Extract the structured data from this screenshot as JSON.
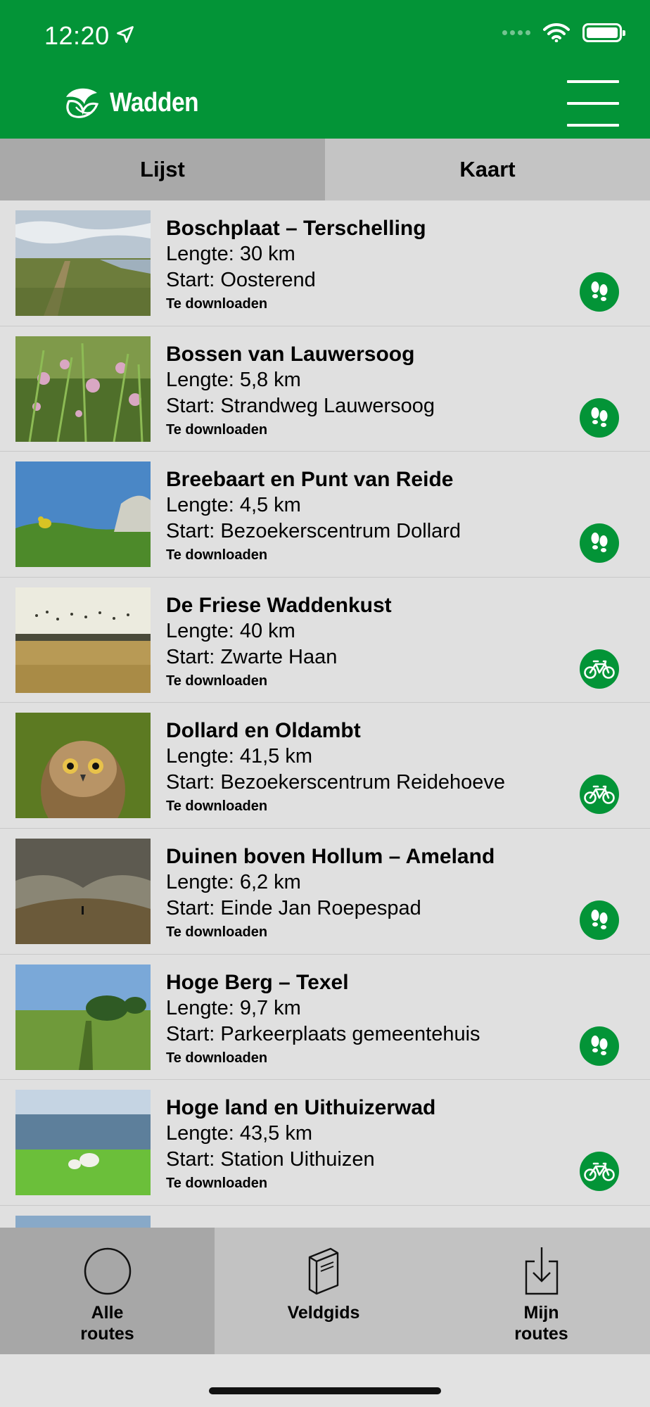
{
  "status_bar": {
    "time": "12:20"
  },
  "header": {
    "app_name": "Wadden"
  },
  "tabs": [
    {
      "label": "Lijst",
      "active": true
    },
    {
      "label": "Kaart",
      "active": false
    }
  ],
  "routes": [
    {
      "title": "Boschplaat – Terschelling",
      "length": "Lengte: 30 km",
      "start": "Start: Oosterend",
      "status": "Te downloaden",
      "mode": "walk"
    },
    {
      "title": "Bossen van Lauwersoog",
      "length": "Lengte: 5,8 km",
      "start": "Start: Strandweg Lauwersoog",
      "status": "Te downloaden",
      "mode": "walk"
    },
    {
      "title": "Breebaart en Punt van Reide",
      "length": "Lengte: 4,5 km",
      "start": "Start: Bezoekerscentrum Dollard",
      "status": "Te downloaden",
      "mode": "walk"
    },
    {
      "title": "De Friese Waddenkust",
      "length": "Lengte: 40 km",
      "start": "Start: Zwarte Haan",
      "status": "Te downloaden",
      "mode": "bike"
    },
    {
      "title": "Dollard en Oldambt",
      "length": "Lengte: 41,5 km",
      "start": "Start: Bezoekerscentrum Reidehoeve",
      "status": "Te downloaden",
      "mode": "bike"
    },
    {
      "title": "Duinen boven Hollum – Ameland",
      "length": "Lengte: 6,2 km",
      "start": "Start: Einde Jan Roepespad",
      "status": "Te downloaden",
      "mode": "walk"
    },
    {
      "title": "Hoge Berg – Texel",
      "length": "Lengte: 9,7 km",
      "start": "Start: Parkeerplaats gemeentehuis",
      "status": "Te downloaden",
      "mode": "walk"
    },
    {
      "title": "Hoge land en Uithuizerwad",
      "length": "Lengte: 43,5 km",
      "start": "Start: Station Uithuizen",
      "status": "Te downloaden",
      "mode": "bike"
    }
  ],
  "bottom_nav": [
    {
      "label": "Alle\nroutes",
      "icon": "circle-icon",
      "selected": true
    },
    {
      "label": "Veldgids",
      "icon": "book-icon",
      "selected": false
    },
    {
      "label": "Mijn\nroutes",
      "icon": "download-icon",
      "selected": false
    }
  ],
  "colors": {
    "brand_green": "#039437",
    "tab_active": "#a9a9a9",
    "tab_inactive": "#c4c4c4",
    "list_bg": "#e0e0e0"
  }
}
